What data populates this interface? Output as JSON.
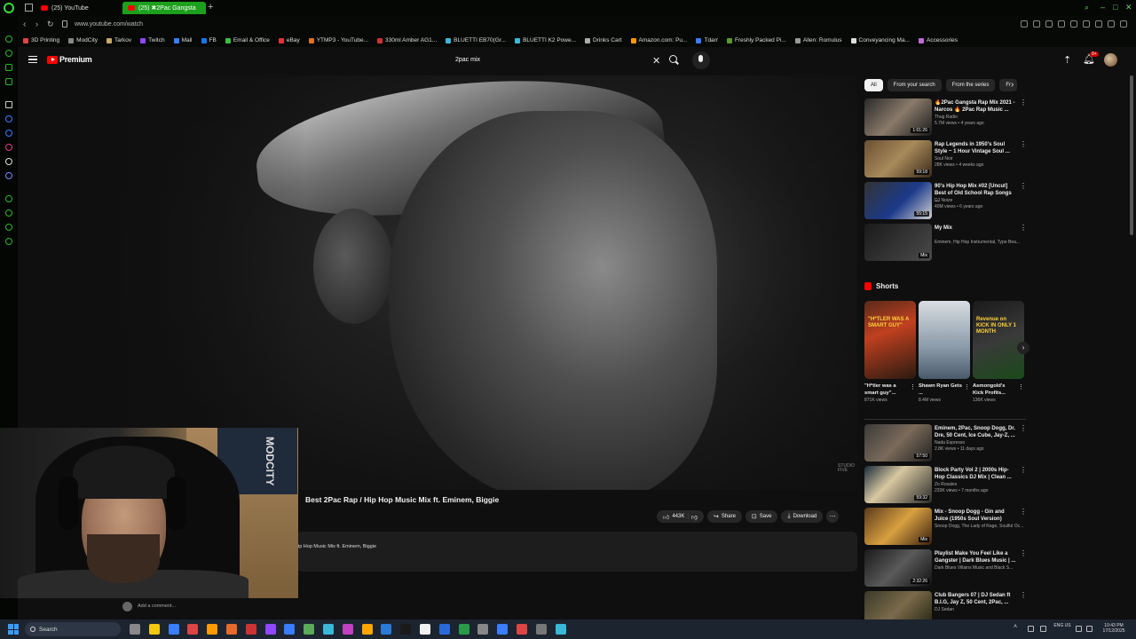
{
  "browser": {
    "tabs": [
      {
        "label": "(25) YouTube"
      },
      {
        "label": "(25) ✖2Pac Gangsta"
      }
    ],
    "url": "www.youtube.com/watch",
    "bookmarks": [
      "3D Printing",
      "ModCity",
      "Tarkov",
      "Twitch",
      "Mail",
      "FB",
      "Email & Office",
      "eBay",
      "YTMP3 - YouTube...",
      "330ml Amber AG1...",
      "BLUETTI EB70(Gr...",
      "BLUETTI K2 Powe...",
      "Drinks Cart",
      "Amazon.com: Pu...",
      "Tdarr",
      "Freshly Packed Pi...",
      "Allen: Romulus",
      "Conveyancing Ma...",
      "Accessories"
    ]
  },
  "youtube": {
    "logo_text": "Premium",
    "search_query": "2pac mix",
    "notification_count": "9+"
  },
  "video": {
    "title": "Best 2Pac Rap / Hip Hop Music Mix ft. Eminem, Biggie",
    "like_count": "443K",
    "share_label": "Share",
    "save_label": "Save",
    "download_label": "Download",
    "description_snippet": "ip Hop Music Mix ft. Eminem, Biggie",
    "add_comment_placeholder": "Add a comment...",
    "watermark": "STUDIO FIVE"
  },
  "chips": [
    "All",
    "From your search",
    "From the series",
    "Fr"
  ],
  "recommended": [
    {
      "title": "🔥2Pac Gangsta Rap Mix 2021 - Narcos 🔥 2Pac Rap Music ...",
      "channel": "Thug Radio",
      "meta": "5.7M views • 4 years ago",
      "duration": "1:01:26"
    },
    {
      "title": "Rap Legends in 1950's Soul Style ~ 1 Hour Vintage Soul ...",
      "channel": "Soul Noir",
      "meta": "28K views • 4 weeks ago",
      "duration": "59:18"
    },
    {
      "title": "90's Hip Hop Mix #02 [Uncut] Best of Old School Rap Songs ...",
      "channel": "DJ Noize",
      "meta": "40M views • 6 years ago",
      "duration": "55:15"
    },
    {
      "title": "My Mix",
      "channel": "Eminem, Hip Hop Instrumental, Type Bea...",
      "meta": "",
      "duration": "Mix"
    }
  ],
  "shorts_section_title": "Shorts",
  "shorts": [
    {
      "title": "\"H*tler was a smart guy\"...",
      "views": "871K views",
      "overlay": "\"H*TLER WAS A SMART GUY\""
    },
    {
      "title": "Shawn Ryan Gets ...",
      "views": "8.4M views",
      "overlay": ""
    },
    {
      "title": "Asmongold's Kick Profits...",
      "views": "136K views",
      "overlay": "Revenue on KICK IN ONLY 1 MONTH"
    }
  ],
  "recommended_more": [
    {
      "title": "Eminem, 2Pac, Snoop Dogg, Dr. Dre, 50 Cent, Ice Cube, Jay-Z, ...",
      "channel": "Nada Espresso",
      "meta": "2.8K views • 11 days ago",
      "duration": "57:50"
    },
    {
      "title": "Block Party Vol 2 | 2000s Hip-Hop Classics DJ Mix | Clean ...",
      "channel": "Zo Rosales",
      "meta": "233K views • 7 months ago",
      "duration": "59:32"
    },
    {
      "title": "Mix - Snoop Dogg - Gin and Juice (1950s Soul Version)",
      "channel": "Snoop Dogg, The Lady of Rage, Soulful Oc...",
      "meta": "",
      "duration": "Mix"
    },
    {
      "title": "Playlist Make You Feel Like a Gangster | Dark Blues Music | ...",
      "channel": "Dark Blues Villains Music and Black S...",
      "meta": "",
      "duration": "2:32:26"
    },
    {
      "title": "Club Bangers 07 | DJ Sedan ft B.I.G, Jay Z, 50 Cent, 2Pac, ...",
      "channel": "DJ Sedan",
      "meta": "",
      "duration": ""
    }
  ],
  "webcam": {
    "poster_text": "MODCITY"
  },
  "taskbar": {
    "search_label": "Search",
    "language": "ENG US",
    "time": "10:43 PM",
    "date": "17/12/2025"
  },
  "colors": {
    "opera_green": "#3adb3a",
    "youtube_red": "#ff0000",
    "background": "#0f0f0f"
  }
}
